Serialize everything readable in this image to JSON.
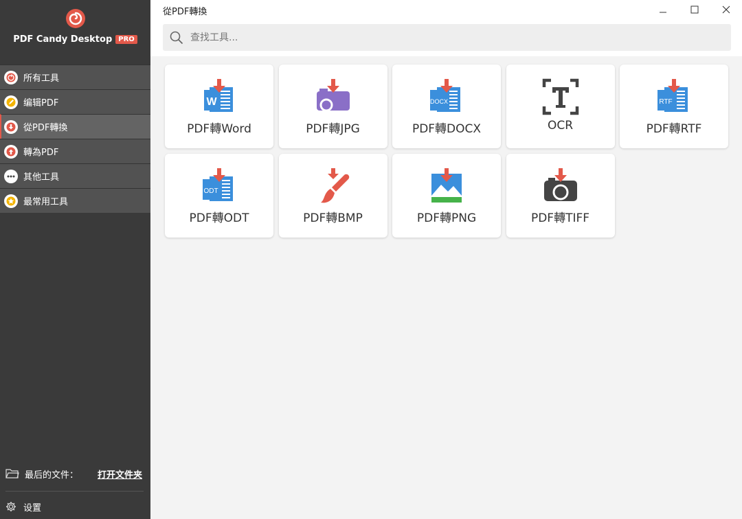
{
  "app": {
    "brand_name": "PDF Candy Desktop",
    "badge": "PRO",
    "window_title": "從PDF轉換"
  },
  "colors": {
    "accent": "#e3594a",
    "blue": "#3b8fdc",
    "purple": "#8a6fc7",
    "green": "#46b34a",
    "dark": "#444444"
  },
  "sidebar": {
    "items": [
      {
        "label": "所有工具",
        "icon": "spiral-icon"
      },
      {
        "label": "编辑PDF",
        "icon": "edit-icon"
      },
      {
        "label": "從PDF轉換",
        "icon": "arrow-down-icon",
        "active": true
      },
      {
        "label": "轉為PDF",
        "icon": "arrow-up-icon"
      },
      {
        "label": "其他工具",
        "icon": "more-icon"
      },
      {
        "label": "最常用工具",
        "icon": "star-icon"
      }
    ],
    "recent_label": "最后的文件：",
    "open_folder": "打开文件夹",
    "settings": "设置"
  },
  "search": {
    "placeholder": "查找工具..."
  },
  "tools": [
    {
      "label": "PDF轉Word",
      "icon": "word-doc-icon"
    },
    {
      "label": "PDF轉JPG",
      "icon": "jpg-camera-icon"
    },
    {
      "label": "PDF轉DOCX",
      "icon": "docx-doc-icon"
    },
    {
      "label": "OCR",
      "icon": "ocr-icon"
    },
    {
      "label": "PDF轉RTF",
      "icon": "rtf-doc-icon"
    },
    {
      "label": "PDF轉ODT",
      "icon": "odt-doc-icon"
    },
    {
      "label": "PDF轉BMP",
      "icon": "bmp-brush-icon"
    },
    {
      "label": "PDF轉PNG",
      "icon": "png-image-icon"
    },
    {
      "label": "PDF轉TIFF",
      "icon": "tiff-camera-icon"
    }
  ],
  "doc_icon_text": {
    "word": "W",
    "docx": "DOCX",
    "rtf": "RTF",
    "odt": "ODT"
  }
}
